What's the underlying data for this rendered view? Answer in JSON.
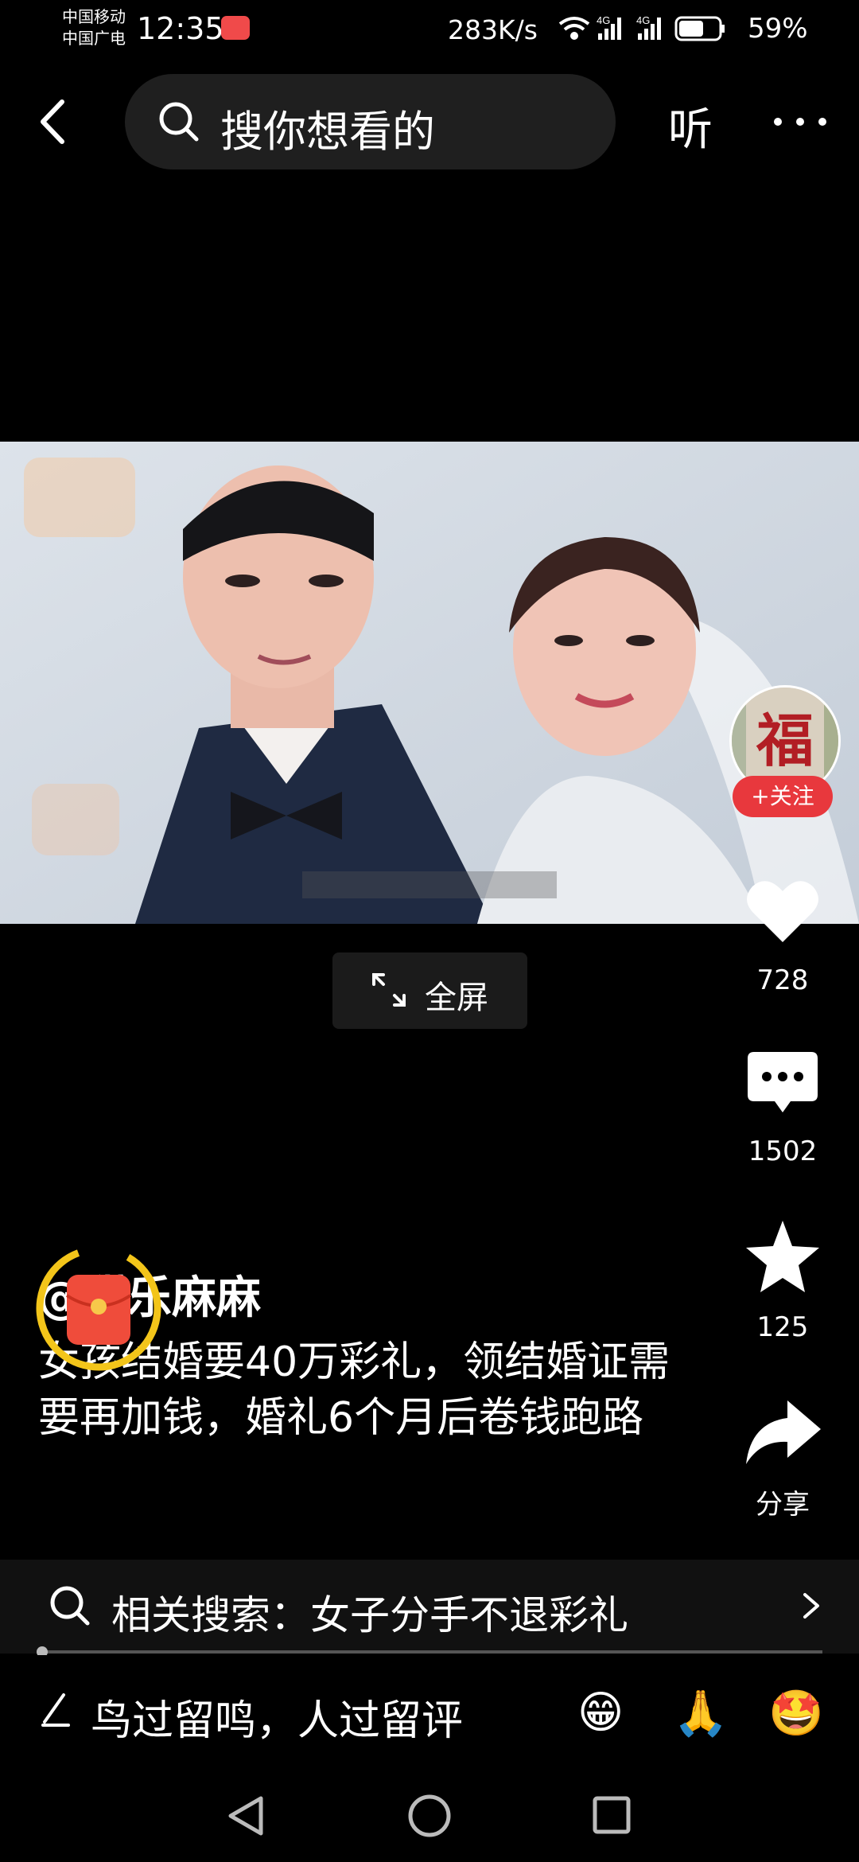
{
  "status_bar": {
    "carrier_1": "中国移动",
    "carrier_2": "中国广电",
    "time": "12:35",
    "net_speed": "283K/s",
    "network_1": "4G",
    "network_2": "4G",
    "battery": "59%"
  },
  "top_nav": {
    "search_placeholder": "搜你想看的",
    "listen_label": "听"
  },
  "video": {
    "fullscreen_label": "全屏"
  },
  "creator": {
    "avatar_glyph": "福",
    "follow_label": "+关注",
    "name": "@甜乐麻麻"
  },
  "actions": {
    "likes": "728",
    "comments": "1502",
    "favorites": "125",
    "share_label": "分享"
  },
  "caption": "女孩结婚要40万彩礼，领结婚证需要再加钱，婚礼6个月后卷钱跑路",
  "related_search": {
    "label": "相关搜索：女子分手不退彩礼"
  },
  "playback": {
    "progress_fraction": 0.005
  },
  "comment_bar": {
    "placeholder": "鸟过留鸣，人过留评",
    "emojis": [
      "😁",
      "🙏",
      "🤩"
    ]
  },
  "colors": {
    "accent_red": "#e8383d",
    "background": "#000000"
  }
}
